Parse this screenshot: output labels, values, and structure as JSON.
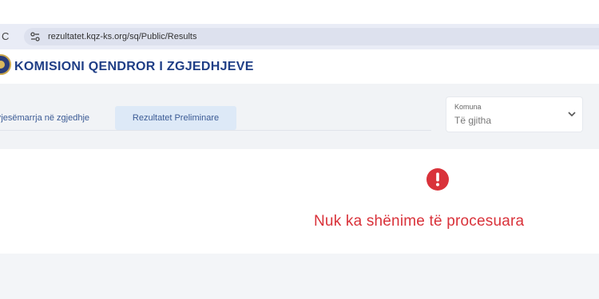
{
  "browser": {
    "reload_icon": "reload-icon",
    "site_settings_icon": "tune-icon",
    "url": "rezultatet.kqz-ks.org/sq/Public/Results"
  },
  "header": {
    "logo_icon": "emblem-logo",
    "org_name": "KOMISIONI QENDROR I ZGJEDHJEVE"
  },
  "nav": {
    "tabs": [
      {
        "label": "Pjesëmarrja në zgjedhje",
        "active": false
      },
      {
        "label": "Rezultatet Preliminare",
        "active": true
      }
    ]
  },
  "filter": {
    "label": "Komuna",
    "value": "Të gjitha",
    "icon": "chevron-down-icon"
  },
  "status": {
    "icon": "alert-circle-icon",
    "message": "Nuk ka shënime të procesuara",
    "color": "#d9323a"
  }
}
